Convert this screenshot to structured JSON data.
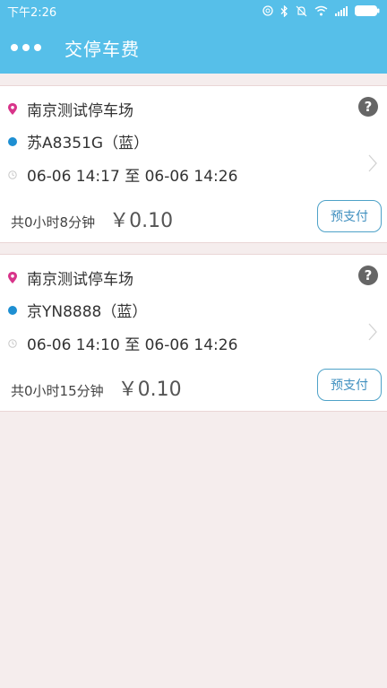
{
  "status_bar": {
    "time": "下午2:26"
  },
  "header": {
    "title": "交停车费"
  },
  "orders": [
    {
      "parking_lot": "南京测试停车场",
      "plate": "苏A8351G（蓝）",
      "time_range": "06-06 14:17 至 06-06 14:26",
      "duration": "共0小时8分钟",
      "amount": "￥0.10",
      "help_label": "?",
      "pay_label": "预支付"
    },
    {
      "parking_lot": "南京测试停车场",
      "plate": "京YN8888（蓝）",
      "time_range": "06-06 14:10 至 06-06 14:26",
      "duration": "共0小时15分钟",
      "amount": "￥0.10",
      "help_label": "?",
      "pay_label": "预支付"
    }
  ],
  "colors": {
    "primary": "#56bfe9",
    "location_pin": "#d8348a",
    "plate_dot": "#1e8fd2",
    "background": "#f5eded"
  }
}
